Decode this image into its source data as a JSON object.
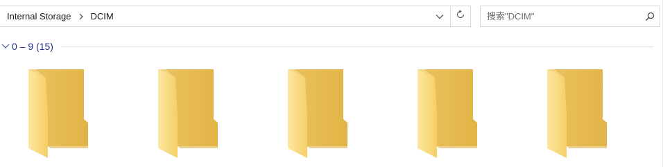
{
  "breadcrumb": {
    "items": [
      "Internal Storage",
      "DCIM"
    ],
    "separator_icon": "chevron-right-icon"
  },
  "address_bar": {
    "dropdown_icon": "chevron-down-icon",
    "refresh_icon": "refresh-icon"
  },
  "search": {
    "placeholder": "搜索\"DCIM\"",
    "value": "",
    "icon": "search-icon"
  },
  "group": {
    "title": "0 – 9 (15)",
    "expanded": true,
    "title_color": "#1e3287"
  },
  "folders": [
    {
      "icon": "folder-icon"
    },
    {
      "icon": "folder-icon"
    },
    {
      "icon": "folder-icon"
    },
    {
      "icon": "folder-icon"
    },
    {
      "icon": "folder-icon"
    }
  ],
  "colors": {
    "folder_back": "#e5b94f",
    "folder_front": "#f8d775",
    "border": "#d9d9d9"
  }
}
